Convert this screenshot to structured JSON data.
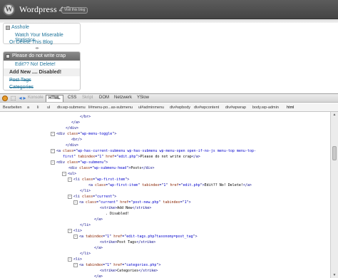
{
  "wp": {
    "title": "Wordpress 4.5",
    "visit_button": "Visit this blog",
    "logo_letter": "W"
  },
  "menu1": {
    "head": "Asshole",
    "items": [
      "Watch Your Miserable Statistics",
      "Or Delete This Blog"
    ]
  },
  "menu2": {
    "head": "Please do not write crap",
    "items": [
      "Edit?? No! Delete!",
      "Add New .... Disabled!",
      "Post Tags",
      "Categories"
    ]
  },
  "firebug": {
    "toolbar_icons": [
      "bug-icon",
      "inspect-icon",
      "back-icon",
      "forward-icon"
    ],
    "tabs": [
      {
        "label": "Konsole",
        "state": "disabled"
      },
      {
        "label": "HTML",
        "state": "active"
      },
      {
        "label": "CSS",
        "state": "normal"
      },
      {
        "label": "Skript",
        "state": "disabled"
      },
      {
        "label": "DOM",
        "state": "normal"
      },
      {
        "label": "Netzwerk",
        "state": "normal"
      },
      {
        "label": "YSlow",
        "state": "normal"
      }
    ],
    "breadcrumb": [
      "Bearbeiten",
      "a",
      "li",
      "ul",
      "div.wp-submenu",
      "li#menu-po...as-submenu",
      "ul#adminmenu",
      "div#wpbody",
      "div#wpcontent",
      "div#wpwrap",
      "body.wp-admin",
      "html"
    ]
  },
  "code_lines": [
    {
      "indent": 112,
      "toggle": "",
      "parts": [
        [
          "tg",
          "</"
        ],
        [
          "tg",
          "br"
        ],
        [
          "tg",
          ">"
        ]
      ]
    },
    {
      "indent": 100,
      "toggle": "",
      "parts": [
        [
          "tg",
          "</a>"
        ]
      ]
    },
    {
      "indent": 92,
      "toggle": "",
      "parts": [
        [
          "tg",
          "</div>"
        ]
      ]
    },
    {
      "indent": 80,
      "toggle": "-",
      "parts": [
        [
          "tg",
          "<div "
        ],
        [
          "an",
          "class"
        ],
        [
          "tg",
          "=\""
        ],
        [
          "av",
          "wp-menu-toggle"
        ],
        [
          "tg",
          "\">"
        ]
      ]
    },
    {
      "indent": 100,
      "toggle": "",
      "parts": [
        [
          "tg",
          "<br/>"
        ]
      ]
    },
    {
      "indent": 92,
      "toggle": "",
      "parts": [
        [
          "tg",
          "</div>"
        ]
      ]
    },
    {
      "indent": 80,
      "toggle": "-",
      "parts": [
        [
          "tg",
          "<a "
        ],
        [
          "an",
          "class"
        ],
        [
          "tg",
          "=\""
        ],
        [
          "av",
          "wp-has-current-submenu wp-has-submenu wp-menu-open open-if-no-js menu-top menu-top-"
        ],
        [
          "tg",
          ""
        ]
      ]
    },
    {
      "indent": 88,
      "toggle": "",
      "parts": [
        [
          "av",
          "first"
        ],
        [
          "tg",
          "\" "
        ],
        [
          "an",
          "tabindex"
        ],
        [
          "tg",
          "=\""
        ],
        [
          "av",
          "1"
        ],
        [
          "tg",
          "\" "
        ],
        [
          "an",
          "href"
        ],
        [
          "tg",
          "=\""
        ],
        [
          "av",
          "edit.php"
        ],
        [
          "tg",
          "\">"
        ],
        [
          "tx",
          "Please do not write crap"
        ],
        [
          "tg",
          "</a>"
        ]
      ]
    },
    {
      "indent": 80,
      "toggle": "-",
      "parts": [
        [
          "tg",
          "<div "
        ],
        [
          "an",
          "class"
        ],
        [
          "tg",
          "=\""
        ],
        [
          "av",
          "wp-submenu"
        ],
        [
          "tg",
          "\">"
        ]
      ]
    },
    {
      "indent": 96,
      "toggle": "",
      "parts": [
        [
          "tg",
          "<div "
        ],
        [
          "an",
          "class"
        ],
        [
          "tg",
          "=\""
        ],
        [
          "av",
          "wp-submenu-head"
        ],
        [
          "tg",
          "\">"
        ],
        [
          "tx",
          "Posts"
        ],
        [
          "tg",
          "</div>"
        ]
      ]
    },
    {
      "indent": 96,
      "toggle": "-",
      "parts": [
        [
          "tg",
          "<ul>"
        ]
      ]
    },
    {
      "indent": 104,
      "toggle": "-",
      "parts": [
        [
          "tg",
          "<li "
        ],
        [
          "an",
          "class"
        ],
        [
          "tg",
          "=\""
        ],
        [
          "av",
          "wp-first-item"
        ],
        [
          "tg",
          "\">"
        ]
      ]
    },
    {
      "indent": 124,
      "toggle": "",
      "parts": [
        [
          "tg",
          "<a "
        ],
        [
          "an",
          "class"
        ],
        [
          "tg",
          "=\""
        ],
        [
          "av",
          "wp-first-item"
        ],
        [
          "tg",
          "\" "
        ],
        [
          "an",
          "tabindex"
        ],
        [
          "tg",
          "=\""
        ],
        [
          "av",
          "1"
        ],
        [
          "tg",
          "\" "
        ],
        [
          "an",
          "href"
        ],
        [
          "tg",
          "=\""
        ],
        [
          "av",
          "edit.php"
        ],
        [
          "tg",
          "\">"
        ],
        [
          "tx",
          "Edit?? No! Delete!"
        ],
        [
          "tg",
          "</a>"
        ]
      ]
    },
    {
      "indent": 112,
      "toggle": "",
      "parts": [
        [
          "tg",
          "</li>"
        ]
      ]
    },
    {
      "indent": 104,
      "toggle": "-",
      "parts": [
        [
          "tg",
          "<li "
        ],
        [
          "an",
          "class"
        ],
        [
          "tg",
          "=\""
        ],
        [
          "av",
          "current"
        ],
        [
          "tg",
          "\">"
        ]
      ]
    },
    {
      "indent": 112,
      "toggle": "-",
      "parts": [
        [
          "tg",
          "<a "
        ],
        [
          "an",
          "class"
        ],
        [
          "tg",
          "=\""
        ],
        [
          "av",
          "current"
        ],
        [
          "tg",
          "\" "
        ],
        [
          "an",
          "href"
        ],
        [
          "tg",
          "=\""
        ],
        [
          "av",
          "post-new.php"
        ],
        [
          "tg",
          "\" "
        ],
        [
          "an",
          "tabindex"
        ],
        [
          "tg",
          "=\""
        ],
        [
          "av",
          "1"
        ],
        [
          "tg",
          "\">"
        ]
      ]
    },
    {
      "indent": 140,
      "toggle": "",
      "parts": [
        [
          "tg",
          "<strike>"
        ],
        [
          "tx",
          "Add New"
        ],
        [
          "tg",
          "</strike>"
        ]
      ]
    },
    {
      "indent": 148,
      "toggle": "",
      "parts": [
        [
          "tx",
          ". Disabled!"
        ]
      ]
    },
    {
      "indent": 132,
      "toggle": "",
      "parts": [
        [
          "tg",
          "</a>"
        ]
      ]
    },
    {
      "indent": 112,
      "toggle": "",
      "parts": [
        [
          "tg",
          "</li>"
        ]
      ]
    },
    {
      "indent": 104,
      "toggle": "-",
      "parts": [
        [
          "tg",
          "<li>"
        ]
      ]
    },
    {
      "indent": 112,
      "toggle": "-",
      "parts": [
        [
          "tg",
          "<a "
        ],
        [
          "an",
          "tabindex"
        ],
        [
          "tg",
          "=\""
        ],
        [
          "av",
          "1"
        ],
        [
          "tg",
          "\" "
        ],
        [
          "an",
          "href"
        ],
        [
          "tg",
          "=\""
        ],
        [
          "av",
          "edit-tags.php?taxonomy=post_tag"
        ],
        [
          "tg",
          "\">"
        ]
      ]
    },
    {
      "indent": 140,
      "toggle": "",
      "parts": [
        [
          "tg",
          "<strike>"
        ],
        [
          "tx",
          "Post Tags"
        ],
        [
          "tg",
          "</strike>"
        ]
      ]
    },
    {
      "indent": 132,
      "toggle": "",
      "parts": [
        [
          "tg",
          "</a>"
        ]
      ]
    },
    {
      "indent": 112,
      "toggle": "",
      "parts": [
        [
          "tg",
          "</li>"
        ]
      ]
    },
    {
      "indent": 104,
      "toggle": "-",
      "parts": [
        [
          "tg",
          "<li>"
        ]
      ]
    },
    {
      "indent": 112,
      "toggle": "-",
      "parts": [
        [
          "tg",
          "<a "
        ],
        [
          "an",
          "tabindex"
        ],
        [
          "tg",
          "=\""
        ],
        [
          "av",
          "1"
        ],
        [
          "tg",
          "\" "
        ],
        [
          "an",
          "href"
        ],
        [
          "tg",
          "=\""
        ],
        [
          "av",
          "categories.php"
        ],
        [
          "tg",
          "\">"
        ]
      ]
    },
    {
      "indent": 140,
      "toggle": "",
      "parts": [
        [
          "tg",
          "<strike>"
        ],
        [
          "tx",
          "Categories"
        ],
        [
          "tg",
          "</strike>"
        ]
      ]
    },
    {
      "indent": 132,
      "toggle": "",
      "parts": [
        [
          "tg",
          "</a>"
        ]
      ]
    },
    {
      "indent": 112,
      "toggle": "",
      "parts": [
        [
          "tg",
          "</li>"
        ]
      ]
    }
  ]
}
